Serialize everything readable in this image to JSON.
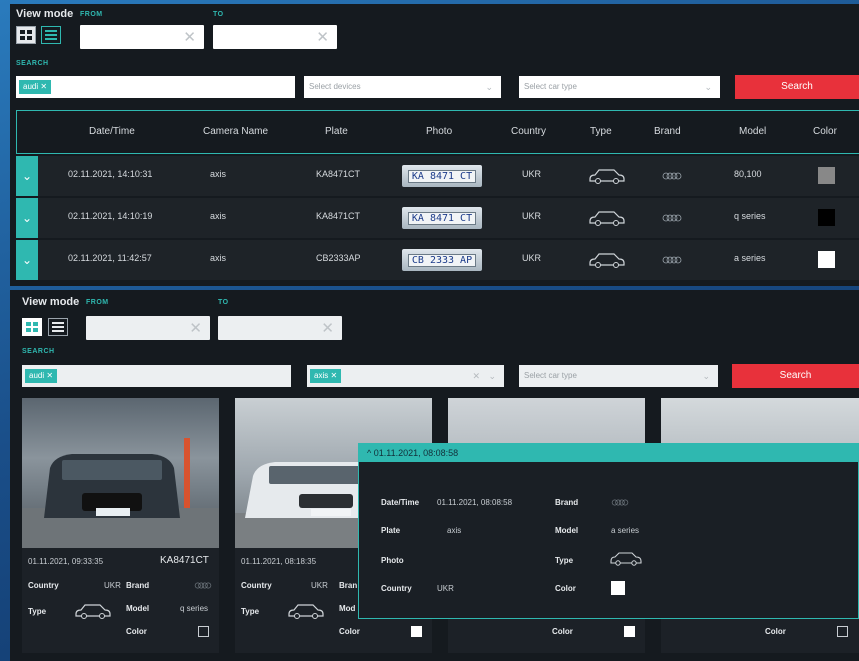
{
  "top": {
    "view_mode_label": "View mode",
    "from_label": "FROM",
    "to_label": "TO",
    "search_label": "SEARCH",
    "search_chip": "audi ✕",
    "devices_placeholder": "Select devices",
    "car_type_placeholder": "Select car type",
    "search_button": "Search",
    "columns": [
      "Date/Time",
      "Camera Name",
      "Plate",
      "Photo",
      "Country",
      "Type",
      "Brand",
      "Model",
      "Color"
    ],
    "rows": [
      {
        "datetime": "02.11.2021, 14:10:31",
        "camera": "axis",
        "plate": "KA8471CT",
        "photo_plate": "KA 8471 CT",
        "country": "UKR",
        "model": "80,100",
        "color": "#888888"
      },
      {
        "datetime": "02.11.2021, 14:10:19",
        "camera": "axis",
        "plate": "KA8471CT",
        "photo_plate": "KA 8471 CT",
        "country": "UKR",
        "model": "q series",
        "color": "#000000"
      },
      {
        "datetime": "02.11.2021, 11:42:57",
        "camera": "axis",
        "plate": "CB2333AP",
        "photo_plate": "CB 2333 AP",
        "country": "UKR",
        "model": "a series",
        "color": "#ffffff"
      }
    ]
  },
  "bottom": {
    "view_mode_label": "View mode",
    "from_label": "FROM",
    "to_label": "TO",
    "search_label": "SEARCH",
    "search_chip": "audi ✕",
    "devices_chip": "axis ✕",
    "car_type_placeholder": "Select car type",
    "search_button": "Search",
    "cards": [
      {
        "timestamp": "01.11.2021, 09:33:35",
        "plate": "KA8471CT",
        "country_label": "Country",
        "country": "UKR",
        "brand_label": "Brand",
        "type_label": "Type",
        "model_label": "Model",
        "model": "q series",
        "color_label": "Color"
      },
      {
        "timestamp": "01.11.2021, 08:18:35",
        "plate": "",
        "country_label": "Country",
        "country": "UKR",
        "brand_label": "Bran",
        "type_label": "Type",
        "model_label": "Mod",
        "model": "",
        "color_label": "Color"
      },
      {
        "color_label": "Color"
      },
      {
        "color_label": "Color"
      }
    ]
  },
  "popup": {
    "header": "01.11.2021, 08:08:58",
    "datetime_label": "Date/Time",
    "datetime": "01.11.2021, 08:08:58",
    "plate_label": "Plate",
    "plate": "axis",
    "photo_label": "Photo",
    "country_label": "Country",
    "country": "UKR",
    "brand_label": "Brand",
    "model_label": "Model",
    "model": "a series",
    "type_label": "Type",
    "color_label": "Color"
  },
  "colors": {
    "accent": "#2fb8b0",
    "search": "#e8313b",
    "panel": "#151a1f"
  },
  "icons": [
    "grid-view-icon",
    "list-view-icon",
    "clear-icon",
    "chevron-down-icon",
    "car-icon",
    "audi-rings-icon"
  ]
}
